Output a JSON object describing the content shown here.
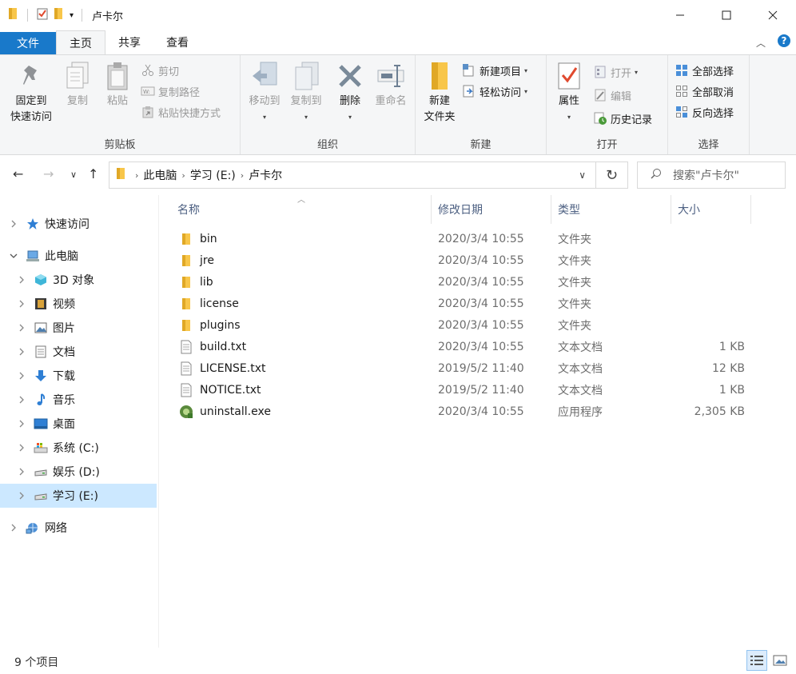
{
  "window": {
    "title": "卢卡尔"
  },
  "tabs": {
    "file": "文件",
    "home": "主页",
    "share": "共享",
    "view": "查看"
  },
  "ribbon": {
    "clipboard": {
      "label": "剪贴板",
      "pin_l1": "固定到",
      "pin_l2": "快速访问",
      "copy": "复制",
      "paste": "粘贴",
      "cut": "剪切",
      "copy_path": "复制路径",
      "paste_shortcut": "粘贴快捷方式"
    },
    "organize": {
      "label": "组织",
      "move_to": "移动到",
      "copy_to": "复制到",
      "delete": "删除",
      "rename": "重命名"
    },
    "new": {
      "label": "新建",
      "new_folder_l1": "新建",
      "new_folder_l2": "文件夹",
      "new_item": "新建项目",
      "easy_access": "轻松访问"
    },
    "open": {
      "label": "打开",
      "properties": "属性",
      "open": "打开",
      "edit": "编辑",
      "history": "历史记录"
    },
    "select": {
      "label": "选择",
      "select_all": "全部选择",
      "select_none": "全部取消",
      "invert": "反向选择"
    }
  },
  "address": {
    "crumbs": [
      "此电脑",
      "学习 (E:)",
      "卢卡尔"
    ],
    "search_placeholder": "搜索\"卢卡尔\""
  },
  "navpane": {
    "items": [
      {
        "label": "快速访问",
        "icon": "star-icon"
      },
      {
        "label": "此电脑",
        "icon": "computer-icon"
      },
      {
        "label": "3D 对象",
        "icon": "cube-icon"
      },
      {
        "label": "视频",
        "icon": "video-icon"
      },
      {
        "label": "图片",
        "icon": "picture-icon"
      },
      {
        "label": "文档",
        "icon": "document-icon"
      },
      {
        "label": "下载",
        "icon": "download-icon"
      },
      {
        "label": "音乐",
        "icon": "music-icon"
      },
      {
        "label": "桌面",
        "icon": "desktop-icon"
      },
      {
        "label": "系统 (C:)",
        "icon": "system-drive-icon"
      },
      {
        "label": "娱乐 (D:)",
        "icon": "drive-icon"
      },
      {
        "label": "学习 (E:)",
        "icon": "drive-icon"
      },
      {
        "label": "网络",
        "icon": "network-icon"
      }
    ]
  },
  "columns": {
    "name": "名称",
    "date": "修改日期",
    "type": "类型",
    "size": "大小"
  },
  "files": [
    {
      "name": "bin",
      "date": "2020/3/4 10:55",
      "type": "文件夹",
      "size": "",
      "icon": "folder-icon"
    },
    {
      "name": "jre",
      "date": "2020/3/4 10:55",
      "type": "文件夹",
      "size": "",
      "icon": "folder-icon"
    },
    {
      "name": "lib",
      "date": "2020/3/4 10:55",
      "type": "文件夹",
      "size": "",
      "icon": "folder-icon"
    },
    {
      "name": "license",
      "date": "2020/3/4 10:55",
      "type": "文件夹",
      "size": "",
      "icon": "folder-icon"
    },
    {
      "name": "plugins",
      "date": "2020/3/4 10:55",
      "type": "文件夹",
      "size": "",
      "icon": "folder-icon"
    },
    {
      "name": "build.txt",
      "date": "2020/3/4 10:55",
      "type": "文本文档",
      "size": "1 KB",
      "icon": "text-file-icon"
    },
    {
      "name": "LICENSE.txt",
      "date": "2019/5/2 11:40",
      "type": "文本文档",
      "size": "12 KB",
      "icon": "text-file-icon"
    },
    {
      "name": "NOTICE.txt",
      "date": "2019/5/2 11:40",
      "type": "文本文档",
      "size": "1 KB",
      "icon": "text-file-icon"
    },
    {
      "name": "uninstall.exe",
      "date": "2020/3/4 10:55",
      "type": "应用程序",
      "size": "2,305 KB",
      "icon": "uninstaller-icon"
    }
  ],
  "status": {
    "count": "9 个项目"
  },
  "colors": {
    "accent": "#1979ca",
    "selected_bg": "#cce8ff",
    "folder": "#f8c64a"
  }
}
